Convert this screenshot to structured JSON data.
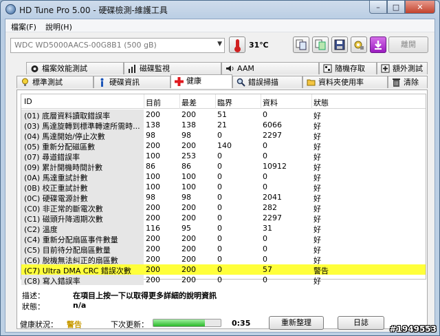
{
  "window": {
    "title": "HD Tune Pro  5.00 - 硬碟檢測-維護工具",
    "min_glyph": "–",
    "max_glyph": "□",
    "close_glyph": "✕"
  },
  "menu": [
    "檔案(F)",
    "說明(H)"
  ],
  "toolbar": {
    "drive": "WDC WD5000AACS-00G8B1 (500 gB)",
    "temperature": "31℃",
    "icons": [
      "copy-text-icon",
      "copy-screenshot-icon",
      "save-icon",
      "options-icon",
      "download-icon"
    ],
    "exit_label": "離開"
  },
  "tabs_row1": [
    {
      "label": "檔案效能測試",
      "icon": "file-benchmark-icon"
    },
    {
      "label": "磁碟監視",
      "icon": "disk-monitor-icon"
    },
    {
      "label": "AAM",
      "icon": "speaker-icon"
    },
    {
      "label": "隨機存取",
      "icon": "random-access-icon"
    },
    {
      "label": "額外測試",
      "icon": "extra-tests-icon"
    }
  ],
  "tabs_row2": [
    {
      "label": "標準測試",
      "icon": "benchmark-icon"
    },
    {
      "label": "硬碟資訊",
      "icon": "info-icon"
    },
    {
      "label": "健康",
      "icon": "health-cross-icon",
      "active": true
    },
    {
      "label": "錯誤掃描",
      "icon": "error-scan-icon"
    },
    {
      "label": "資料夾使用率",
      "icon": "folder-usage-icon"
    },
    {
      "label": "清除",
      "icon": "erase-icon"
    }
  ],
  "table": {
    "columns": [
      "ID",
      "目前",
      "最差",
      "臨界",
      "資料",
      "狀態"
    ],
    "rows": [
      [
        "(01) 底層資料讀取錯誤率",
        "200",
        "200",
        "51",
        "0",
        "好"
      ],
      [
        "(03) 馬達旋轉到標準轉速所需時...",
        "138",
        "138",
        "21",
        "6066",
        "好"
      ],
      [
        "(04) 馬達開始/停止次數",
        "98",
        "98",
        "0",
        "2297",
        "好"
      ],
      [
        "(05) 重新分配磁區數",
        "200",
        "200",
        "140",
        "0",
        "好"
      ],
      [
        "(07) 尋道錯誤率",
        "100",
        "253",
        "0",
        "0",
        "好"
      ],
      [
        "(09) 累計開機時間計數",
        "86",
        "86",
        "0",
        "10912",
        "好"
      ],
      [
        "(0A) 馬達重試計數",
        "100",
        "100",
        "0",
        "0",
        "好"
      ],
      [
        "(0B) 校正重試計數",
        "100",
        "100",
        "0",
        "0",
        "好"
      ],
      [
        "(0C) 硬碟電源計數",
        "98",
        "98",
        "0",
        "2041",
        "好"
      ],
      [
        "(C0) 非正常的斷電次數",
        "200",
        "200",
        "0",
        "282",
        "好"
      ],
      [
        "(C1) 磁頭升降週期次數",
        "200",
        "200",
        "0",
        "2297",
        "好"
      ],
      [
        "(C2) 溫度",
        "116",
        "95",
        "0",
        "31",
        "好"
      ],
      [
        "(C4) 重新分配扇區事件數量",
        "200",
        "200",
        "0",
        "0",
        "好"
      ],
      [
        "(C5) 目前待分配扇區數量",
        "200",
        "200",
        "0",
        "0",
        "好"
      ],
      [
        "(C6) 脫機無法糾正的扇區數",
        "200",
        "200",
        "0",
        "0",
        "好"
      ],
      [
        "(C7) Ultra DMA CRC 錯誤次數",
        "200",
        "200",
        "0",
        "57",
        "警告"
      ],
      [
        "(C8) 寫入錯誤率",
        "200",
        "200",
        "0",
        "0",
        "好"
      ]
    ],
    "alert_row_index": 15,
    "alert_color": "#ffff3a"
  },
  "details": {
    "desc_label": "描述：",
    "desc_value": "在項目上按一下以取得更多詳細的說明資訊",
    "status_label": "狀態：",
    "status_value": "n/a"
  },
  "status_bar": {
    "health_label": "健康狀況：",
    "health_value": "警告",
    "next_update_label": "下次更新：",
    "progress_fraction": 0.77,
    "time_remaining": "0:35",
    "refresh_label": "重新整理",
    "log_label": "日誌"
  },
  "watermark": "#1949553"
}
